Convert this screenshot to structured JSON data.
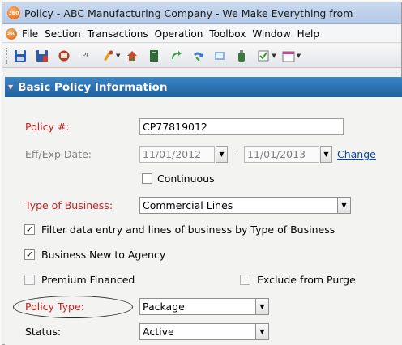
{
  "window": {
    "title": "Policy - ABC Manufacturing Company - We Make Everything from",
    "logo_text": "360"
  },
  "menu": {
    "items": [
      "File",
      "Section",
      "Transactions",
      "Operation",
      "Toolbox",
      "Window",
      "Help"
    ]
  },
  "toolbar": {
    "icons": [
      "save-icon",
      "save-all-icon",
      "print-icon",
      "pl-icon",
      "paint-icon",
      "home-icon",
      "notebook-icon",
      "refresh-icon",
      "redo-icon",
      "document-icon",
      "bottle-icon",
      "checklist-icon",
      "calendar-icon"
    ],
    "pl_label": "PL"
  },
  "section": {
    "title": "Basic Policy Information"
  },
  "form": {
    "policy_number": {
      "label": "Policy #:",
      "value": "CP77819012"
    },
    "eff_exp": {
      "label": "Eff/Exp Date:",
      "eff_value": "11/01/2012",
      "exp_value": "11/01/2013",
      "separator": "-",
      "change_link": "Change"
    },
    "continuous": {
      "label": "Continuous",
      "checked": false
    },
    "type_of_business": {
      "label": "Type of Business:",
      "value": "Commercial Lines"
    },
    "filter_entry": {
      "label": "Filter data entry and lines of business by Type of Business",
      "checked": true
    },
    "business_new": {
      "label": "Business New to Agency",
      "checked": true
    },
    "premium_financed": {
      "label": "Premium Financed",
      "checked": false
    },
    "exclude_purge": {
      "label": "Exclude from Purge",
      "checked": false
    },
    "policy_type": {
      "label": "Policy Type:",
      "value": "Package"
    },
    "status": {
      "label": "Status:",
      "value": "Active"
    }
  },
  "colors": {
    "section_header": "#1f5f9c",
    "required_label": "#cc2020",
    "link": "#0645ad"
  }
}
